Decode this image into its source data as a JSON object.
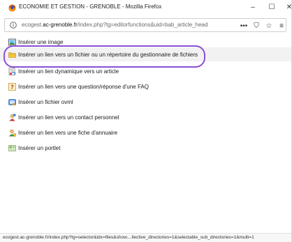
{
  "window": {
    "title": "ECONOMIE ET GESTION - GRENOBLE - Mozilla Firefox",
    "controls": {
      "minimize": "–",
      "maximize": "☐",
      "close": "✕"
    }
  },
  "urlbar": {
    "prefix": "ecogest.",
    "domain": "ac-grenoble.fr",
    "path": "/index.php?tg=editorfunctions&uid=bab_article_head",
    "page_actions": "•••",
    "pocket": "⛉",
    "bookmark": "☆",
    "overflow": "≡"
  },
  "menu": {
    "items": [
      {
        "label": "Insérer une image",
        "icon": "image-icon"
      },
      {
        "label": "Insérer un lien vers un fichier ou un répertoire du gestionnaire de fichiers",
        "icon": "folder-icon"
      },
      {
        "label": "Insérer un lien dynamique vers un article",
        "icon": "article-link-icon"
      },
      {
        "label": "Insérer un lien vers une question/réponse d'une FAQ",
        "icon": "faq-icon"
      },
      {
        "label": "Insérer un fichier ovml",
        "icon": "ovml-icon"
      },
      {
        "label": "Insérer un lien vers un contact personnel",
        "icon": "contact-icon"
      },
      {
        "label": "Insérer un lien vers une fiche d'annuaire",
        "icon": "directory-icon"
      },
      {
        "label": "Insérer un portlet",
        "icon": "portlet-icon"
      }
    ]
  },
  "statusbar": {
    "text": "ecogest.ac-grenoble.fr/index.php?tg=selector&idx=files&show....llective_directories=1&selectable_sub_directories=1&multi=1"
  },
  "colors": {
    "highlight_ring": "#8a4fd8",
    "highlight_row": "#f2f2f2"
  }
}
